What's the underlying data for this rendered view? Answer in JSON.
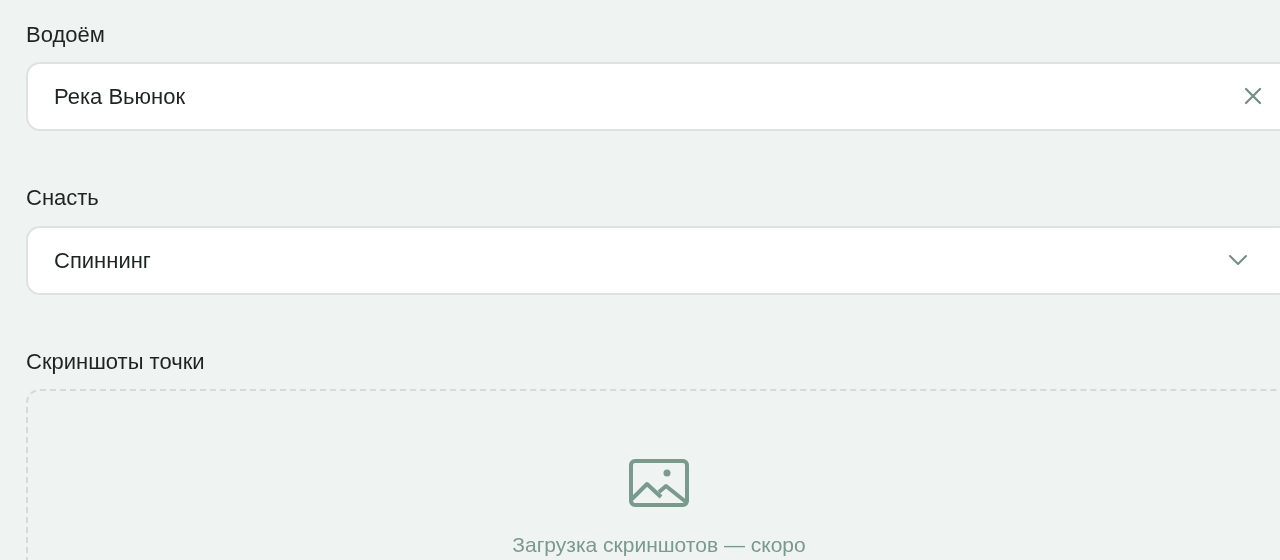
{
  "fields": [
    {
      "kind": "text",
      "label": "Водоём",
      "value": "Река Вьюнок",
      "clearable": true
    },
    {
      "kind": "select",
      "label": "Снасть",
      "value": "Спиннинг"
    }
  ],
  "screenshots": {
    "label": "Скриншоты точки",
    "note": "Загрузка скриншотов — скоро"
  }
}
